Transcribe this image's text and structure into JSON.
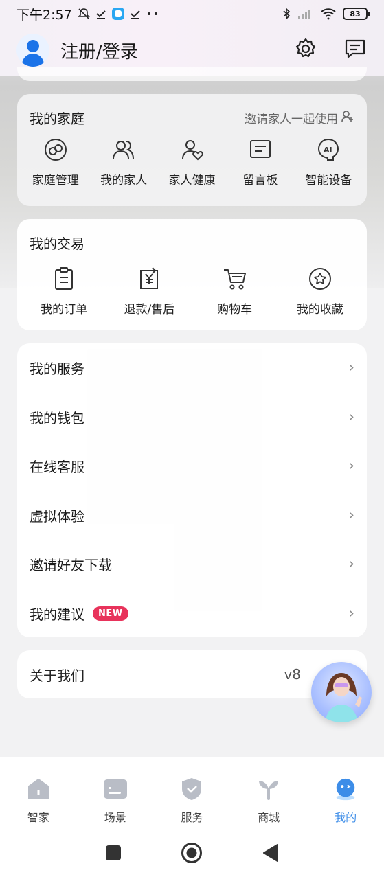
{
  "status_bar": {
    "time": "下午2:57",
    "battery": "83"
  },
  "header": {
    "login_label": "注册/登录"
  },
  "family": {
    "title": "我的家庭",
    "invite_label": "邀请家人一起使用",
    "items": [
      {
        "label": "家庭管理",
        "icon": "family-manage-icon"
      },
      {
        "label": "我的家人",
        "icon": "family-members-icon"
      },
      {
        "label": "家人健康",
        "icon": "family-health-icon"
      },
      {
        "label": "留言板",
        "icon": "message-board-icon"
      },
      {
        "label": "智能设备",
        "icon": "ai-device-icon"
      }
    ]
  },
  "trade": {
    "title": "我的交易",
    "items": [
      {
        "label": "我的订单",
        "icon": "order-icon"
      },
      {
        "label": "退款/售后",
        "icon": "refund-icon"
      },
      {
        "label": "购物车",
        "icon": "cart-icon"
      },
      {
        "label": "我的收藏",
        "icon": "favorite-icon"
      }
    ]
  },
  "menu": {
    "items": [
      {
        "label": "我的服务"
      },
      {
        "label": "我的钱包"
      },
      {
        "label": "在线客服"
      },
      {
        "label": "虚拟体验"
      },
      {
        "label": "邀请好友下载"
      },
      {
        "label": "我的建议",
        "badge": "NEW"
      }
    ]
  },
  "about": {
    "label": "关于我们",
    "version": "v8"
  },
  "bottom_nav": {
    "items": [
      {
        "label": "智家",
        "icon": "home-icon"
      },
      {
        "label": "场景",
        "icon": "scene-icon"
      },
      {
        "label": "服务",
        "icon": "service-shield-icon"
      },
      {
        "label": "商城",
        "icon": "mall-icon"
      },
      {
        "label": "我的",
        "icon": "me-icon",
        "active": true
      }
    ]
  },
  "colors": {
    "accent": "#3d8de8",
    "badge": "#e8335b",
    "avatar": "#1b73e8"
  }
}
